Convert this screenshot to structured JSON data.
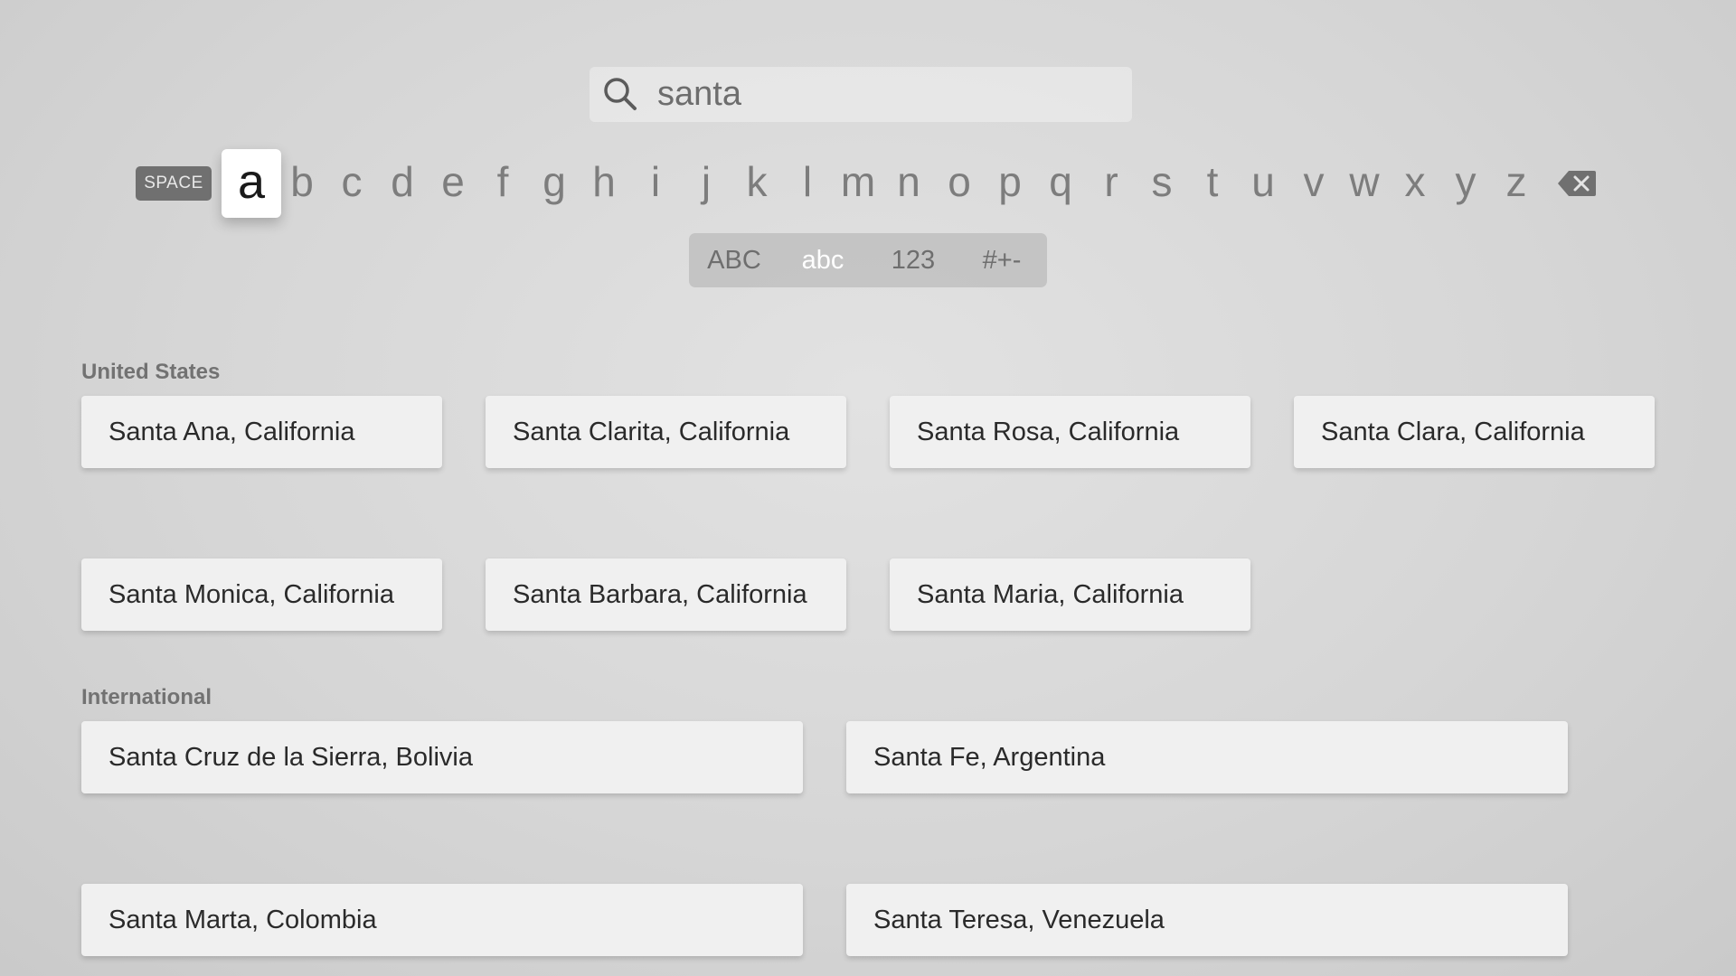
{
  "search": {
    "query": "santa",
    "icon": "search-icon"
  },
  "keyboard": {
    "space_label": "SPACE",
    "focused_letter": "a",
    "letters": [
      "a",
      "b",
      "c",
      "d",
      "e",
      "f",
      "g",
      "h",
      "i",
      "j",
      "k",
      "l",
      "m",
      "n",
      "o",
      "p",
      "q",
      "r",
      "s",
      "t",
      "u",
      "v",
      "w",
      "x",
      "y",
      "z"
    ],
    "delete_icon": "backspace-icon"
  },
  "modes": {
    "items": [
      "ABC",
      "abc",
      "123",
      "#+-"
    ],
    "active": "abc"
  },
  "sections": {
    "us": {
      "heading": "United States",
      "results": [
        "Santa Ana, California",
        "Santa Clarita, California",
        "Santa Rosa, California",
        "Santa Clara, California",
        "Santa Monica, California",
        "Santa Barbara, California",
        "Santa Maria, California"
      ]
    },
    "international": {
      "heading": "International",
      "results": [
        "Santa Cruz de la Sierra, Bolivia",
        "Santa Fe, Argentina",
        "Santa Marta, Colombia",
        "Santa Teresa, Venezuela"
      ]
    }
  },
  "colors": {
    "background": "#d6d6d6",
    "card": "#f0f0f0",
    "focused_key": "#ffffff",
    "text_muted": "#7d7d7d"
  }
}
